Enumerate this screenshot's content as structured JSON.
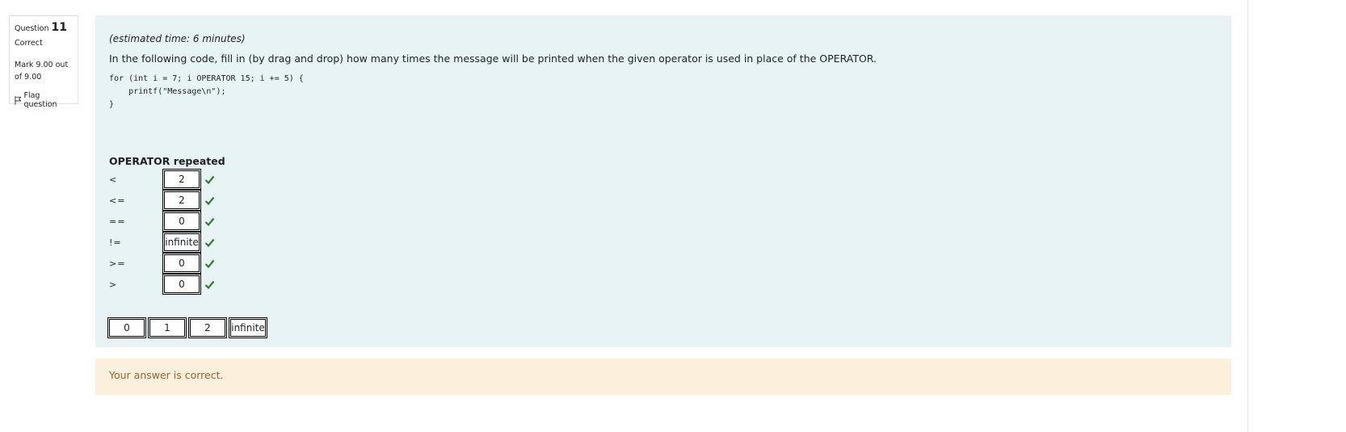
{
  "info": {
    "question_word": "Question",
    "question_number": "11",
    "state": "Correct",
    "grade": "Mark 9.00 out of 9.00",
    "flag_label": "Flag question"
  },
  "formulation": {
    "estimated_time": "(estimated time: 6 minutes)",
    "question_text": "In the following code, fill in (by drag and drop) how many times the message will be printed when the given operator is used in place of the OPERATOR.",
    "code": "for (int i = 7; i OPERATOR 15; i += 5) {\n    printf(\"Message\\n\");\n}",
    "table_header": "OPERATOR repeated",
    "rows": [
      {
        "operator": "<",
        "answer": "2"
      },
      {
        "operator": "<=",
        "answer": "2"
      },
      {
        "operator": "==",
        "answer": "0"
      },
      {
        "operator": "!=",
        "answer": "infinite"
      },
      {
        "operator": ">=",
        "answer": "0"
      },
      {
        "operator": ">",
        "answer": "0"
      }
    ],
    "choices": [
      "0",
      "1",
      "2",
      "infinite"
    ]
  },
  "feedback": "Your answer is correct.",
  "colors": {
    "formulation_bg": "#e7f3f5",
    "feedback_bg": "#fcefdc",
    "check": "#357a32"
  }
}
